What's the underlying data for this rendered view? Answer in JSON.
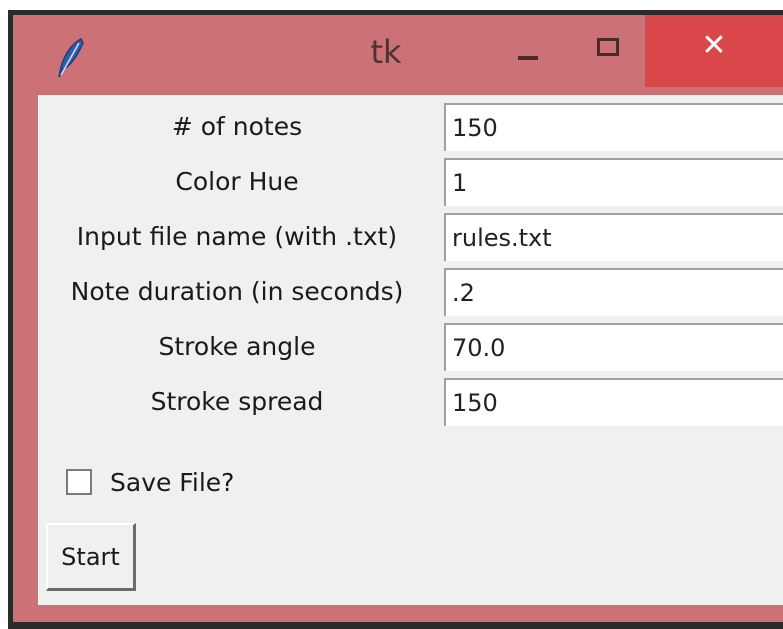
{
  "window": {
    "title": "tk",
    "accent_color": "#cc7176",
    "close_color": "#d9474b",
    "icons": {
      "app": "feather-icon",
      "minimize": "minimize-icon",
      "maximize": "maximize-icon",
      "close": "close-icon"
    }
  },
  "form": {
    "fields": [
      {
        "label": "# of notes",
        "value": "150"
      },
      {
        "label": "Color Hue",
        "value": "1"
      },
      {
        "label": "Input file name (with .txt)",
        "value": "rules.txt"
      },
      {
        "label": "Note duration (in seconds)",
        "value": ".2"
      },
      {
        "label": "Stroke angle",
        "value": "70.0"
      },
      {
        "label": "Stroke spread",
        "value": "150"
      }
    ],
    "save_file": {
      "label": "Save File?",
      "checked": false
    },
    "start_label": "Start"
  }
}
